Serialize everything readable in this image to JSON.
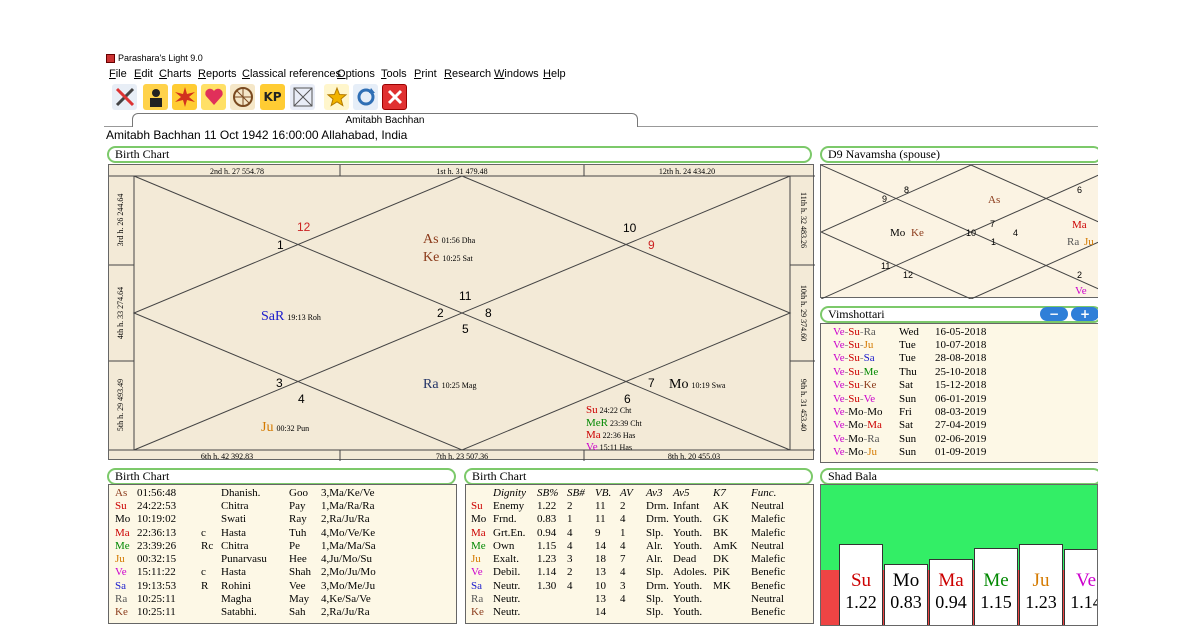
{
  "window": {
    "title": "Parashara's Light 9.0"
  },
  "menu": [
    "File",
    "Edit",
    "Charts",
    "Reports",
    "Classical references",
    "Options",
    "Tools",
    "Print",
    "Research",
    "Windows",
    "Help"
  ],
  "toolbar": {
    "kp_label": "KP"
  },
  "tab": {
    "label": "Amitabh Bachhan"
  },
  "info": "Amitabh Bachhan 11 Oct 1942 16:00:00  Allahabad, India",
  "birth_chart": {
    "title": "Birth Chart",
    "top_labels": [
      "2nd h.  27  554.78",
      "1st h.  31  479.48",
      "12th h.  24  434.20"
    ],
    "bottom_labels": [
      "6th h.  42  392.83",
      "7th h.  23  507.36",
      "8th h.  20  455.03"
    ],
    "left_labels": [
      "3rd h.  26  244.64",
      "4th h.  33  274.64",
      "5th h.  29  493.49"
    ],
    "right_labels": [
      "11th h.  32  483.26",
      "10th h.  29  374.60",
      "9th h.  31  453.40"
    ],
    "house_numbers": [
      "12",
      "1",
      "10",
      "9",
      "11",
      "2",
      "8",
      "5",
      "3",
      "4",
      "6",
      "7"
    ],
    "planets": {
      "as": {
        "name": "As",
        "deg": "01:56 Dha",
        "color": "#8b3a1a"
      },
      "ke": {
        "name": "Ke",
        "deg": "10:25 Sat",
        "color": "#8b3a1a"
      },
      "sa": {
        "name": "SaR",
        "deg": "19:13 Roh",
        "color": "#1a1acc"
      },
      "ra": {
        "name": "Ra",
        "deg": "10:25 Mag",
        "color": "#223366"
      },
      "mo": {
        "name": "Mo",
        "deg": "10:19 Swa",
        "color": "#000000"
      },
      "ju": {
        "name": "Ju",
        "deg": "00:32 Pun",
        "color": "#d47a00"
      },
      "su": {
        "name": "Su",
        "deg": "24:22 Cht",
        "color": "#cc0000"
      },
      "me": {
        "name": "MeR",
        "deg": "23:39 Cht",
        "color": "#008800"
      },
      "ma": {
        "name": "Ma",
        "deg": "22:36 Has",
        "color": "#cc0000"
      },
      "ve": {
        "name": "Ve",
        "deg": "15:11 Has",
        "color": "#cc00cc"
      }
    }
  },
  "navamsha": {
    "title": "D9 Navamsha  (spouse)",
    "numbers": [
      "9",
      "8",
      "6",
      "7",
      "10",
      "4",
      "1",
      "11",
      "12",
      "2"
    ],
    "planets": {
      "as": "As",
      "mo": "Mo",
      "ke": "Ke",
      "ma": "Ma",
      "ra": "Ra",
      "ju": "Ju",
      "ve": "Ve"
    }
  },
  "vimshottari": {
    "title": "Vimshottari",
    "minus": "−",
    "plus": "+",
    "rows": [
      {
        "p": [
          "Ve",
          "Su",
          "Ra"
        ],
        "day": "Wed",
        "date": "16-05-2018"
      },
      {
        "p": [
          "Ve",
          "Su",
          "Ju"
        ],
        "day": "Tue",
        "date": "10-07-2018"
      },
      {
        "p": [
          "Ve",
          "Su",
          "Sa"
        ],
        "day": "Tue",
        "date": "28-08-2018"
      },
      {
        "p": [
          "Ve",
          "Su",
          "Me"
        ],
        "day": "Thu",
        "date": "25-10-2018"
      },
      {
        "p": [
          "Ve",
          "Su",
          "Ke"
        ],
        "day": "Sat",
        "date": "15-12-2018"
      },
      {
        "p": [
          "Ve",
          "Su",
          "Ve"
        ],
        "day": "Sun",
        "date": "06-01-2019"
      },
      {
        "p": [
          "Ve",
          "Mo",
          "Mo"
        ],
        "day": "Fri",
        "date": "08-03-2019"
      },
      {
        "p": [
          "Ve",
          "Mo",
          "Ma"
        ],
        "day": "Sat",
        "date": "27-04-2019"
      },
      {
        "p": [
          "Ve",
          "Mo",
          "Ra"
        ],
        "day": "Sun",
        "date": "02-06-2019"
      },
      {
        "p": [
          "Ve",
          "Mo",
          "Ju"
        ],
        "day": "Sun",
        "date": "01-09-2019"
      }
    ]
  },
  "planet_colors": {
    "Su": "#cc0000",
    "Mo": "#000000",
    "Ma": "#cc0000",
    "Me": "#008800",
    "Ju": "#d47a00",
    "Ve": "#cc00cc",
    "Sa": "#1a1acc",
    "Ra": "#555555",
    "Ke": "#8b3a1a",
    "As": "#8b3a1a"
  },
  "positions": {
    "title": "Birth Chart",
    "rows": [
      [
        "As",
        "01:56:48",
        "",
        "Dhanish.",
        "Goo",
        "3,Ma/Ke/Ve"
      ],
      [
        "Su",
        "24:22:53",
        "",
        "Chitra",
        "Pay",
        "1,Ma/Ra/Ra"
      ],
      [
        "Mo",
        "10:19:02",
        "",
        "Swati",
        "Ray",
        "2,Ra/Ju/Ra"
      ],
      [
        "Ma",
        "22:36:13",
        "c",
        "Hasta",
        "Tuh",
        "4,Mo/Ve/Ke"
      ],
      [
        "Me",
        "23:39:26",
        "Rc",
        "Chitra",
        "Pe",
        "1,Ma/Ma/Sa"
      ],
      [
        "Ju",
        "00:32:15",
        "",
        "Punarvasu",
        "Hee",
        "4,Ju/Mo/Su"
      ],
      [
        "Ve",
        "15:11:22",
        "c",
        "Hasta",
        "Shah",
        "2,Mo/Ju/Mo"
      ],
      [
        "Sa",
        "19:13:53",
        "R",
        "Rohini",
        "Vee",
        "3,Mo/Me/Ju"
      ],
      [
        "Ra",
        "10:25:11",
        "",
        "Magha",
        "May",
        "4,Ke/Sa/Ve"
      ],
      [
        "Ke",
        "10:25:11",
        "",
        "Satabhi.",
        "Sah",
        "2,Ra/Ju/Ra"
      ]
    ]
  },
  "dignity": {
    "title": "Birth Chart",
    "headers": [
      "Dignity",
      "SB%",
      "SB#",
      "VB.",
      "AV",
      "Av3",
      "Av5",
      "K7",
      "Func."
    ],
    "rows": [
      [
        "Su",
        "Enemy",
        "1.22",
        "2",
        "11",
        "2",
        "Drm.",
        "Infant",
        "AK",
        "Neutral"
      ],
      [
        "Mo",
        "Frnd.",
        "0.83",
        "1",
        "11",
        "4",
        "Drm.",
        "Youth.",
        "GK",
        "Malefic"
      ],
      [
        "Ma",
        "Grt.En.",
        "0.94",
        "4",
        "9",
        "1",
        "Slp.",
        "Youth.",
        "BK",
        "Malefic"
      ],
      [
        "Me",
        "Own",
        "1.15",
        "4",
        "14",
        "4",
        "Alr.",
        "Youth.",
        "AmK",
        "Neutral"
      ],
      [
        "Ju",
        "Exalt.",
        "1.23",
        "3",
        "18",
        "7",
        "Alr.",
        "Dead",
        "DK",
        "Malefic"
      ],
      [
        "Ve",
        "Debil.",
        "1.14",
        "2",
        "13",
        "4",
        "Slp.",
        "Adoles.",
        "PiK",
        "Benefic"
      ],
      [
        "Sa",
        "Neutr.",
        "1.30",
        "4",
        "10",
        "3",
        "Drm.",
        "Youth.",
        "MK",
        "Benefic"
      ],
      [
        "Ra",
        "Neutr.",
        "",
        "",
        "13",
        "4",
        "Slp.",
        "Youth.",
        "",
        "Neutral"
      ],
      [
        "Ke",
        "Neutr.",
        "",
        "",
        "14",
        "",
        "Slp.",
        "Youth.",
        "",
        "Benefic"
      ]
    ]
  },
  "shadbala": {
    "title": "Shad Bala",
    "bars": [
      {
        "name": "Su",
        "value": "1.22",
        "ratio": 1.22
      },
      {
        "name": "Mo",
        "value": "0.83",
        "ratio": 0.83
      },
      {
        "name": "Ma",
        "value": "0.94",
        "ratio": 0.94
      },
      {
        "name": "Me",
        "value": "1.15",
        "ratio": 1.15
      },
      {
        "name": "Ju",
        "value": "1.23",
        "ratio": 1.23
      },
      {
        "name": "Ve",
        "value": "1.14",
        "ratio": 1.14
      }
    ],
    "colors": {
      "above": "#33ee66",
      "below": "#ee4444"
    }
  }
}
